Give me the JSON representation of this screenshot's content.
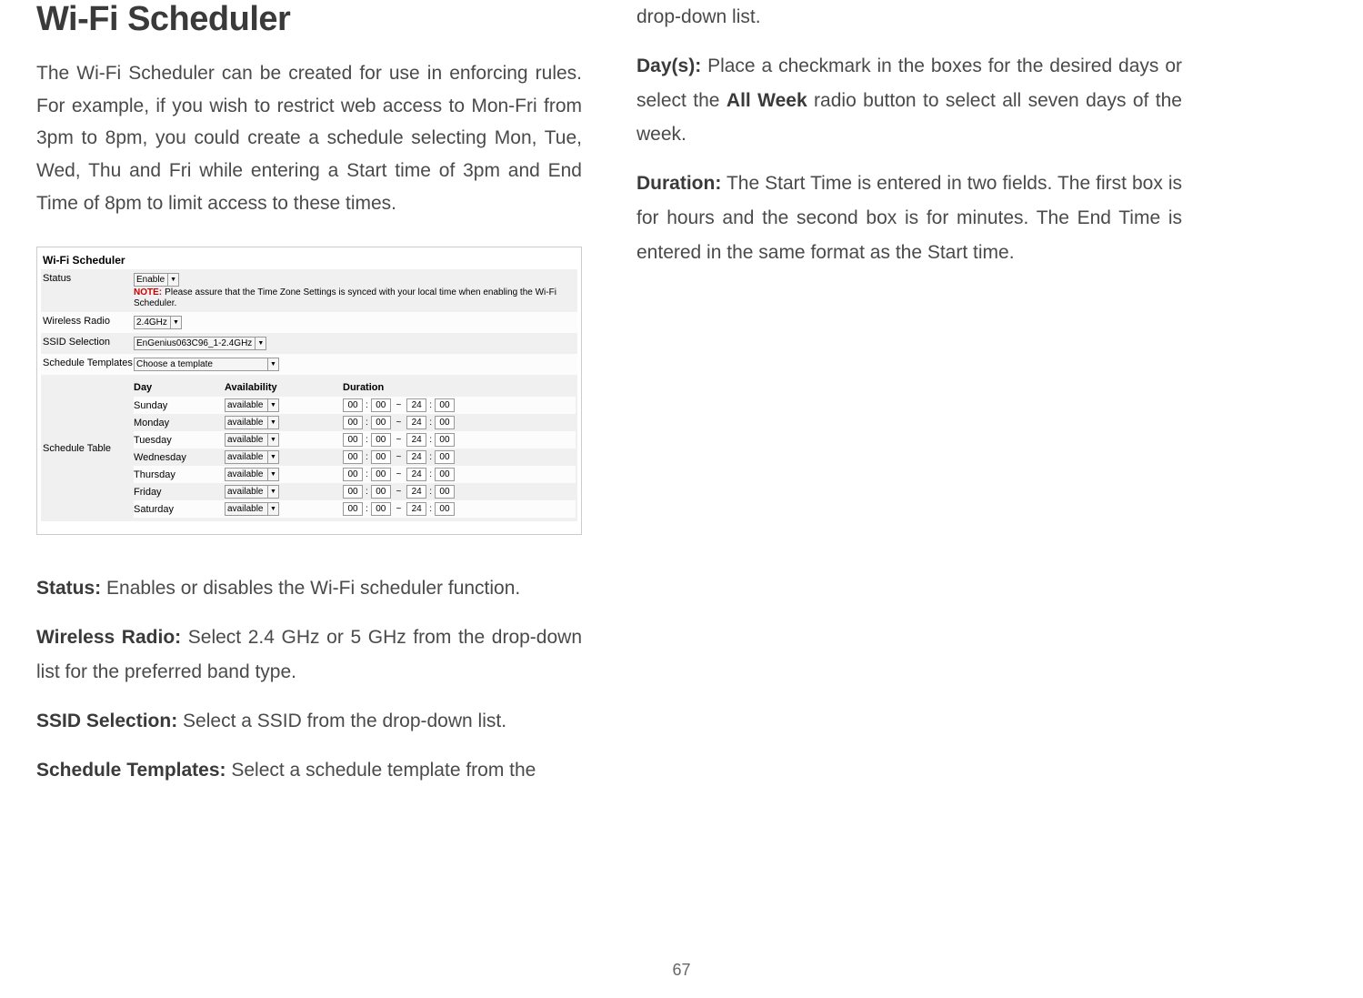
{
  "page_number": "67",
  "heading": "Wi-Fi Scheduler",
  "intro": "The Wi-Fi Scheduler can be created for use in enforcing rules. For example, if you wish to restrict web access to Mon-Fri from 3pm to 8pm, you could create a schedule selecting Mon, Tue, Wed, Thu and Fri while entering a Start time of 3pm and End Time of 8pm to limit access to these times.",
  "screenshot": {
    "panel_title": "Wi-Fi Scheduler",
    "rows": {
      "status_label": "Status",
      "status_value": "Enable",
      "note_label": "NOTE:",
      "note_text": "Please assure that the Time Zone Settings is synced with your local time when enabling the Wi-Fi Scheduler.",
      "radio_label": "Wireless Radio",
      "radio_value": "2.4GHz",
      "ssid_label": "SSID Selection",
      "ssid_value": "EnGenius063C96_1-2.4GHz",
      "templates_label": "Schedule Templates",
      "templates_value": "Choose a template",
      "schedtable_label": "Schedule Table"
    },
    "table_headers": {
      "day": "Day",
      "availability": "Availability",
      "duration": "Duration"
    },
    "table_rows": [
      {
        "day": "Sunday",
        "avail": "available",
        "sh": "00",
        "sm": "00",
        "eh": "24",
        "em": "00"
      },
      {
        "day": "Monday",
        "avail": "available",
        "sh": "00",
        "sm": "00",
        "eh": "24",
        "em": "00"
      },
      {
        "day": "Tuesday",
        "avail": "available",
        "sh": "00",
        "sm": "00",
        "eh": "24",
        "em": "00"
      },
      {
        "day": "Wednesday",
        "avail": "available",
        "sh": "00",
        "sm": "00",
        "eh": "24",
        "em": "00"
      },
      {
        "day": "Thursday",
        "avail": "available",
        "sh": "00",
        "sm": "00",
        "eh": "24",
        "em": "00"
      },
      {
        "day": "Friday",
        "avail": "available",
        "sh": "00",
        "sm": "00",
        "eh": "24",
        "em": "00"
      },
      {
        "day": "Saturday",
        "avail": "available",
        "sh": "00",
        "sm": "00",
        "eh": "24",
        "em": "00"
      }
    ]
  },
  "defs": {
    "status_term": "Status:",
    "status_text": " Enables or disables the Wi-Fi scheduler function.",
    "radio_term": "Wireless Radio:",
    "radio_text": " Select 2.4 GHz or 5 GHz from the drop-down list for the preferred band type.",
    "ssid_term": "SSID Selection:",
    "ssid_text": " Select a SSID from the drop-down list.",
    "templates_term": "Schedule Templates:",
    "templates_text": " Select a schedule template from the ",
    "templates_cont": "drop-down list.",
    "days_term": "Day(s):",
    "days_text": " Place a checkmark in the boxes for the desired days or select the ",
    "days_bold": "All Week",
    "days_text2": " radio button to select all seven days of the week.",
    "duration_term": "Duration:",
    "duration_text": " The Start Time is entered in two fields. The first box is for hours and the second box is for minutes. The End Time is entered in the same format as the Start time."
  }
}
